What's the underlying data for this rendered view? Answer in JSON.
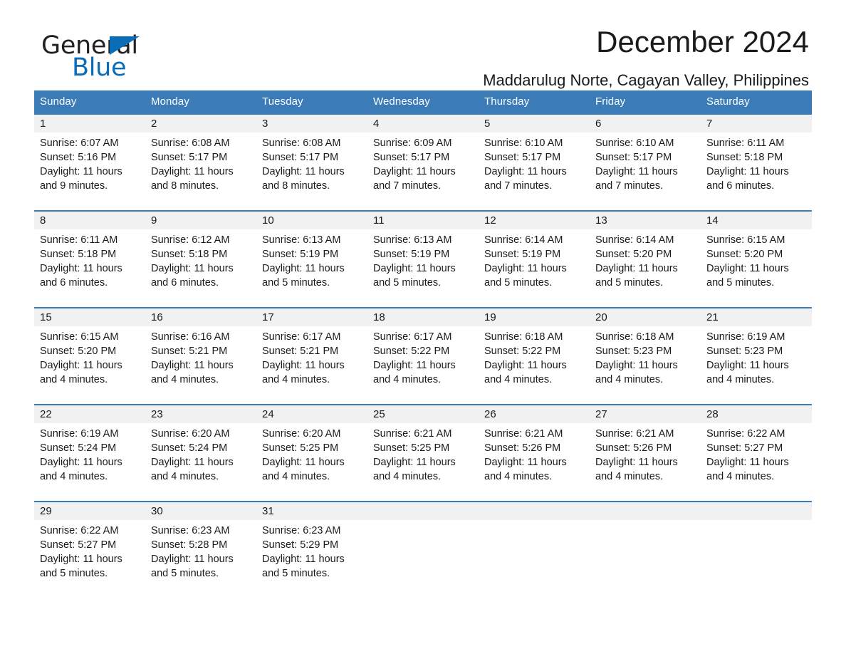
{
  "brand": {
    "name_part1": "General",
    "name_part2": "Blue",
    "accent_color": "#0b6cb7"
  },
  "header": {
    "title": "December 2024",
    "subtitle": "Maddarulug Norte, Cagayan Valley, Philippines"
  },
  "theme": {
    "header_blue": "#3b7cb8",
    "daynum_gray": "#f1f1f1",
    "text": "#1a1a1a"
  },
  "weekdays": [
    "Sunday",
    "Monday",
    "Tuesday",
    "Wednesday",
    "Thursday",
    "Friday",
    "Saturday"
  ],
  "weeks": [
    [
      {
        "day": "1",
        "sunrise": "Sunrise: 6:07 AM",
        "sunset": "Sunset: 5:16 PM",
        "daylight_line1": "Daylight: 11 hours",
        "daylight_line2": "and 9 minutes."
      },
      {
        "day": "2",
        "sunrise": "Sunrise: 6:08 AM",
        "sunset": "Sunset: 5:17 PM",
        "daylight_line1": "Daylight: 11 hours",
        "daylight_line2": "and 8 minutes."
      },
      {
        "day": "3",
        "sunrise": "Sunrise: 6:08 AM",
        "sunset": "Sunset: 5:17 PM",
        "daylight_line1": "Daylight: 11 hours",
        "daylight_line2": "and 8 minutes."
      },
      {
        "day": "4",
        "sunrise": "Sunrise: 6:09 AM",
        "sunset": "Sunset: 5:17 PM",
        "daylight_line1": "Daylight: 11 hours",
        "daylight_line2": "and 7 minutes."
      },
      {
        "day": "5",
        "sunrise": "Sunrise: 6:10 AM",
        "sunset": "Sunset: 5:17 PM",
        "daylight_line1": "Daylight: 11 hours",
        "daylight_line2": "and 7 minutes."
      },
      {
        "day": "6",
        "sunrise": "Sunrise: 6:10 AM",
        "sunset": "Sunset: 5:17 PM",
        "daylight_line1": "Daylight: 11 hours",
        "daylight_line2": "and 7 minutes."
      },
      {
        "day": "7",
        "sunrise": "Sunrise: 6:11 AM",
        "sunset": "Sunset: 5:18 PM",
        "daylight_line1": "Daylight: 11 hours",
        "daylight_line2": "and 6 minutes."
      }
    ],
    [
      {
        "day": "8",
        "sunrise": "Sunrise: 6:11 AM",
        "sunset": "Sunset: 5:18 PM",
        "daylight_line1": "Daylight: 11 hours",
        "daylight_line2": "and 6 minutes."
      },
      {
        "day": "9",
        "sunrise": "Sunrise: 6:12 AM",
        "sunset": "Sunset: 5:18 PM",
        "daylight_line1": "Daylight: 11 hours",
        "daylight_line2": "and 6 minutes."
      },
      {
        "day": "10",
        "sunrise": "Sunrise: 6:13 AM",
        "sunset": "Sunset: 5:19 PM",
        "daylight_line1": "Daylight: 11 hours",
        "daylight_line2": "and 5 minutes."
      },
      {
        "day": "11",
        "sunrise": "Sunrise: 6:13 AM",
        "sunset": "Sunset: 5:19 PM",
        "daylight_line1": "Daylight: 11 hours",
        "daylight_line2": "and 5 minutes."
      },
      {
        "day": "12",
        "sunrise": "Sunrise: 6:14 AM",
        "sunset": "Sunset: 5:19 PM",
        "daylight_line1": "Daylight: 11 hours",
        "daylight_line2": "and 5 minutes."
      },
      {
        "day": "13",
        "sunrise": "Sunrise: 6:14 AM",
        "sunset": "Sunset: 5:20 PM",
        "daylight_line1": "Daylight: 11 hours",
        "daylight_line2": "and 5 minutes."
      },
      {
        "day": "14",
        "sunrise": "Sunrise: 6:15 AM",
        "sunset": "Sunset: 5:20 PM",
        "daylight_line1": "Daylight: 11 hours",
        "daylight_line2": "and 5 minutes."
      }
    ],
    [
      {
        "day": "15",
        "sunrise": "Sunrise: 6:15 AM",
        "sunset": "Sunset: 5:20 PM",
        "daylight_line1": "Daylight: 11 hours",
        "daylight_line2": "and 4 minutes."
      },
      {
        "day": "16",
        "sunrise": "Sunrise: 6:16 AM",
        "sunset": "Sunset: 5:21 PM",
        "daylight_line1": "Daylight: 11 hours",
        "daylight_line2": "and 4 minutes."
      },
      {
        "day": "17",
        "sunrise": "Sunrise: 6:17 AM",
        "sunset": "Sunset: 5:21 PM",
        "daylight_line1": "Daylight: 11 hours",
        "daylight_line2": "and 4 minutes."
      },
      {
        "day": "18",
        "sunrise": "Sunrise: 6:17 AM",
        "sunset": "Sunset: 5:22 PM",
        "daylight_line1": "Daylight: 11 hours",
        "daylight_line2": "and 4 minutes."
      },
      {
        "day": "19",
        "sunrise": "Sunrise: 6:18 AM",
        "sunset": "Sunset: 5:22 PM",
        "daylight_line1": "Daylight: 11 hours",
        "daylight_line2": "and 4 minutes."
      },
      {
        "day": "20",
        "sunrise": "Sunrise: 6:18 AM",
        "sunset": "Sunset: 5:23 PM",
        "daylight_line1": "Daylight: 11 hours",
        "daylight_line2": "and 4 minutes."
      },
      {
        "day": "21",
        "sunrise": "Sunrise: 6:19 AM",
        "sunset": "Sunset: 5:23 PM",
        "daylight_line1": "Daylight: 11 hours",
        "daylight_line2": "and 4 minutes."
      }
    ],
    [
      {
        "day": "22",
        "sunrise": "Sunrise: 6:19 AM",
        "sunset": "Sunset: 5:24 PM",
        "daylight_line1": "Daylight: 11 hours",
        "daylight_line2": "and 4 minutes."
      },
      {
        "day": "23",
        "sunrise": "Sunrise: 6:20 AM",
        "sunset": "Sunset: 5:24 PM",
        "daylight_line1": "Daylight: 11 hours",
        "daylight_line2": "and 4 minutes."
      },
      {
        "day": "24",
        "sunrise": "Sunrise: 6:20 AM",
        "sunset": "Sunset: 5:25 PM",
        "daylight_line1": "Daylight: 11 hours",
        "daylight_line2": "and 4 minutes."
      },
      {
        "day": "25",
        "sunrise": "Sunrise: 6:21 AM",
        "sunset": "Sunset: 5:25 PM",
        "daylight_line1": "Daylight: 11 hours",
        "daylight_line2": "and 4 minutes."
      },
      {
        "day": "26",
        "sunrise": "Sunrise: 6:21 AM",
        "sunset": "Sunset: 5:26 PM",
        "daylight_line1": "Daylight: 11 hours",
        "daylight_line2": "and 4 minutes."
      },
      {
        "day": "27",
        "sunrise": "Sunrise: 6:21 AM",
        "sunset": "Sunset: 5:26 PM",
        "daylight_line1": "Daylight: 11 hours",
        "daylight_line2": "and 4 minutes."
      },
      {
        "day": "28",
        "sunrise": "Sunrise: 6:22 AM",
        "sunset": "Sunset: 5:27 PM",
        "daylight_line1": "Daylight: 11 hours",
        "daylight_line2": "and 4 minutes."
      }
    ],
    [
      {
        "day": "29",
        "sunrise": "Sunrise: 6:22 AM",
        "sunset": "Sunset: 5:27 PM",
        "daylight_line1": "Daylight: 11 hours",
        "daylight_line2": "and 5 minutes."
      },
      {
        "day": "30",
        "sunrise": "Sunrise: 6:23 AM",
        "sunset": "Sunset: 5:28 PM",
        "daylight_line1": "Daylight: 11 hours",
        "daylight_line2": "and 5 minutes."
      },
      {
        "day": "31",
        "sunrise": "Sunrise: 6:23 AM",
        "sunset": "Sunset: 5:29 PM",
        "daylight_line1": "Daylight: 11 hours",
        "daylight_line2": "and 5 minutes."
      },
      {
        "day": "",
        "sunrise": "",
        "sunset": "",
        "daylight_line1": "",
        "daylight_line2": ""
      },
      {
        "day": "",
        "sunrise": "",
        "sunset": "",
        "daylight_line1": "",
        "daylight_line2": ""
      },
      {
        "day": "",
        "sunrise": "",
        "sunset": "",
        "daylight_line1": "",
        "daylight_line2": ""
      },
      {
        "day": "",
        "sunrise": "",
        "sunset": "",
        "daylight_line1": "",
        "daylight_line2": ""
      }
    ]
  ]
}
